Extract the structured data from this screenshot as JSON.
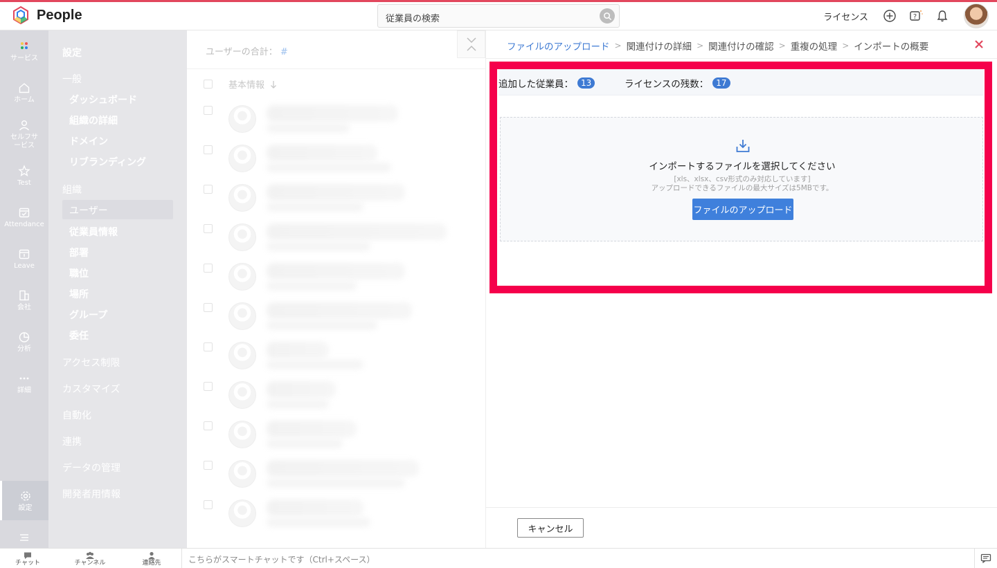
{
  "app": {
    "name": "People"
  },
  "search": {
    "placeholder": "従業員の検索"
  },
  "header": {
    "license_link": "ライセンス"
  },
  "rail": {
    "items": [
      {
        "label": "サービス",
        "icon": "grid-dots-icon"
      },
      {
        "label": "ホーム",
        "icon": "home-icon"
      },
      {
        "label": "セルフサービス",
        "icon": "person-icon"
      },
      {
        "label": "Test",
        "icon": "star-icon"
      },
      {
        "label": "Attendance",
        "icon": "calendar-check-icon"
      },
      {
        "label": "Leave",
        "icon": "calendar-icon"
      },
      {
        "label": "会社",
        "icon": "building-icon"
      },
      {
        "label": "分析",
        "icon": "pie-chart-icon"
      },
      {
        "label": "詳細",
        "icon": "more-dots-icon"
      },
      {
        "label": "設定",
        "icon": "gear-icon"
      }
    ]
  },
  "settings_menu": {
    "title": "設定",
    "general": {
      "heading": "一般",
      "items": [
        "ダッシュボード",
        "組織の詳細",
        "ドメイン",
        "リブランディング"
      ]
    },
    "org": {
      "heading": "組織",
      "items": [
        "ユーザー",
        "従業員情報",
        "部署",
        "職位",
        "場所",
        "グループ",
        "委任"
      ]
    },
    "sections": [
      "アクセス制限",
      "カスタマイズ",
      "自動化",
      "連携",
      "データの管理",
      "開発者用情報"
    ]
  },
  "user_list": {
    "total_label": "ユーザーの合計：",
    "total_value": "#",
    "column_header": "基本情報"
  },
  "import_panel": {
    "breadcrumb": [
      "ファイルのアップロード",
      "関連付けの詳細",
      "関連付けの確認",
      "重複の処理",
      "インポートの概要"
    ],
    "stats": {
      "added_label": "追加した従業員：",
      "added_count": "13",
      "license_label": "ライセンスの残数：",
      "license_count": "17"
    },
    "dropzone": {
      "title": "インポートするファイルを選択してください",
      "hint_formats": "[xls、xlsx、csv形式のみ対応しています]",
      "hint_size": "アップロードできるファイルの最大サイズは5MBです。",
      "upload_button": "ファイルのアップロード"
    },
    "cancel_button": "キャンセル",
    "highlight_color": "#f5004b",
    "accent_color": "#3e7ad3"
  },
  "bottom_bar": {
    "items": [
      {
        "label": "チャット",
        "icon": "chat-icon"
      },
      {
        "label": "チャンネル",
        "icon": "channel-icon"
      },
      {
        "label": "連絡先",
        "icon": "contacts-icon"
      }
    ],
    "chat_placeholder": "こちらがスマートチャットです（Ctrl+スペース）"
  }
}
